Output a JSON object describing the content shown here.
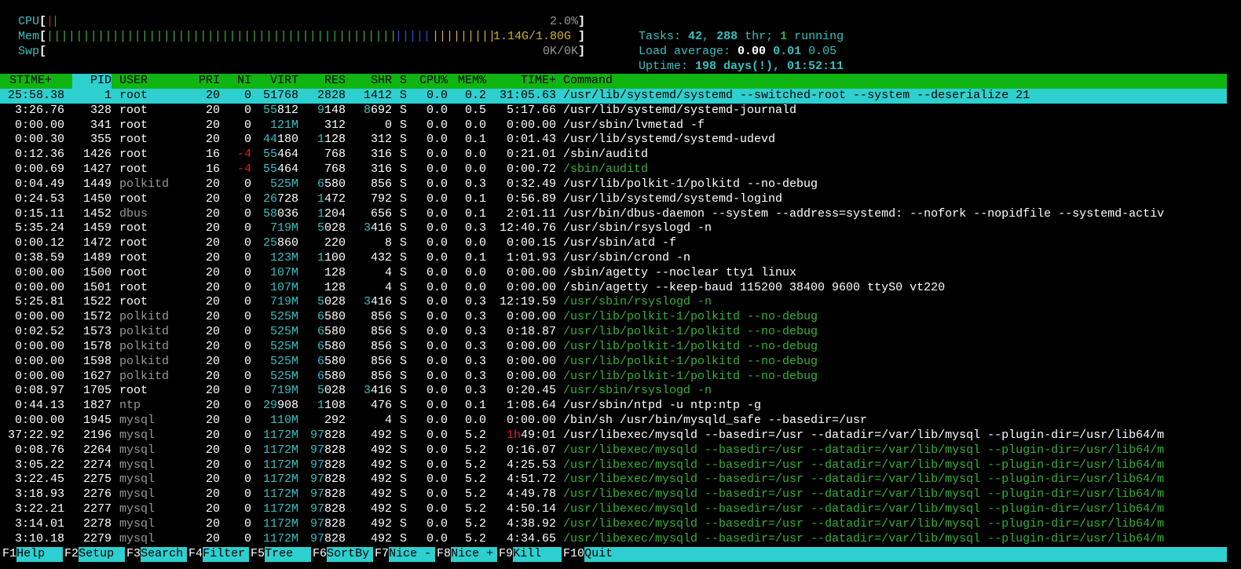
{
  "meters": {
    "cpu": {
      "label": "CPU",
      "value": "2.0%"
    },
    "mem": {
      "label": "Mem",
      "value": "1.14G/1.80G"
    },
    "swp": {
      "label": "Swp",
      "value": "0K/0K"
    }
  },
  "summary": {
    "tasks_label": "Tasks: ",
    "tasks": "42",
    "thr_sep": ", ",
    "thr": "288",
    "thr_label": " thr; ",
    "running": "1",
    "running_label": " running",
    "load_label": "Load average: ",
    "load1": "0.00",
    "load5": "0.01",
    "load15": "0.05",
    "uptime_label": "Uptime: ",
    "uptime": "198 days(!), 01:52:11"
  },
  "columns": [
    "STIME+",
    "PID",
    "USER",
    "PRI",
    "NI",
    "VIRT",
    "RES",
    "SHR",
    "S",
    "CPU%",
    "MEM%",
    "TIME+",
    "Command"
  ],
  "rows": [
    {
      "stime": "25:58.38",
      "pid": "1",
      "user": "root",
      "pri": "20",
      "ni": "0",
      "virt": "51768",
      "res": "2828",
      "shr": "1412",
      "s": "S",
      "cpu": "0.0",
      "mem": "0.2",
      "time": "31:05.63",
      "cmd": "/usr/lib/systemd/systemd --switched-root --system --deserialize 21",
      "selected": true
    },
    {
      "stime": "3:26.76",
      "pid": "328",
      "user": "root",
      "pri": "20",
      "ni": "0",
      "virt": "55812",
      "res": "9148",
      "shr": "8692",
      "s": "S",
      "cpu": "0.0",
      "mem": "0.5",
      "time": "5:17.66",
      "cmd": "/usr/lib/systemd/systemd-journald"
    },
    {
      "stime": "0:00.00",
      "pid": "341",
      "user": "root",
      "pri": "20",
      "ni": "0",
      "virt": "121M",
      "res": "312",
      "shr": "0",
      "s": "S",
      "cpu": "0.0",
      "mem": "0.0",
      "time": "0:00.00",
      "cmd": "/usr/sbin/lvmetad -f"
    },
    {
      "stime": "0:00.30",
      "pid": "355",
      "user": "root",
      "pri": "20",
      "ni": "0",
      "virt": "44180",
      "res": "1128",
      "shr": "312",
      "s": "S",
      "cpu": "0.0",
      "mem": "0.1",
      "time": "0:01.43",
      "cmd": "/usr/lib/systemd/systemd-udevd"
    },
    {
      "stime": "0:12.36",
      "pid": "1426",
      "user": "root",
      "pri": "16",
      "ni": "-4",
      "virt": "55464",
      "res": "768",
      "shr": "316",
      "s": "S",
      "cpu": "0.0",
      "mem": "0.0",
      "time": "0:21.01",
      "cmd": "/sbin/auditd"
    },
    {
      "stime": "0:00.69",
      "pid": "1427",
      "user": "root",
      "pri": "16",
      "ni": "-4",
      "virt": "55464",
      "res": "768",
      "shr": "316",
      "s": "S",
      "cpu": "0.0",
      "mem": "0.0",
      "time": "0:00.72",
      "cmd": "/sbin/auditd",
      "thread": true
    },
    {
      "stime": "0:04.49",
      "pid": "1449",
      "user": "polkitd",
      "pri": "20",
      "ni": "0",
      "virt": "525M",
      "res": "6580",
      "shr": "856",
      "s": "S",
      "cpu": "0.0",
      "mem": "0.3",
      "time": "0:32.49",
      "cmd": "/usr/lib/polkit-1/polkitd --no-debug"
    },
    {
      "stime": "0:24.53",
      "pid": "1450",
      "user": "root",
      "pri": "20",
      "ni": "0",
      "virt": "26728",
      "res": "1472",
      "shr": "792",
      "s": "S",
      "cpu": "0.0",
      "mem": "0.1",
      "time": "0:56.89",
      "cmd": "/usr/lib/systemd/systemd-logind"
    },
    {
      "stime": "0:15.11",
      "pid": "1452",
      "user": "dbus",
      "pri": "20",
      "ni": "0",
      "virt": "58036",
      "res": "1204",
      "shr": "656",
      "s": "S",
      "cpu": "0.0",
      "mem": "0.1",
      "time": "2:01.11",
      "cmd": "/usr/bin/dbus-daemon --system --address=systemd: --nofork --nopidfile --systemd-activ"
    },
    {
      "stime": "5:35.24",
      "pid": "1459",
      "user": "root",
      "pri": "20",
      "ni": "0",
      "virt": "719M",
      "res": "5028",
      "shr": "3416",
      "s": "S",
      "cpu": "0.0",
      "mem": "0.3",
      "time": "12:40.76",
      "cmd": "/usr/sbin/rsyslogd -n"
    },
    {
      "stime": "0:00.12",
      "pid": "1472",
      "user": "root",
      "pri": "20",
      "ni": "0",
      "virt": "25860",
      "res": "220",
      "shr": "8",
      "s": "S",
      "cpu": "0.0",
      "mem": "0.0",
      "time": "0:00.15",
      "cmd": "/usr/sbin/atd -f"
    },
    {
      "stime": "0:38.59",
      "pid": "1489",
      "user": "root",
      "pri": "20",
      "ni": "0",
      "virt": "123M",
      "res": "1100",
      "shr": "432",
      "s": "S",
      "cpu": "0.0",
      "mem": "0.1",
      "time": "1:01.93",
      "cmd": "/usr/sbin/crond -n"
    },
    {
      "stime": "0:00.00",
      "pid": "1500",
      "user": "root",
      "pri": "20",
      "ni": "0",
      "virt": "107M",
      "res": "128",
      "shr": "4",
      "s": "S",
      "cpu": "0.0",
      "mem": "0.0",
      "time": "0:00.00",
      "cmd": "/sbin/agetty --noclear tty1 linux"
    },
    {
      "stime": "0:00.00",
      "pid": "1501",
      "user": "root",
      "pri": "20",
      "ni": "0",
      "virt": "107M",
      "res": "128",
      "shr": "4",
      "s": "S",
      "cpu": "0.0",
      "mem": "0.0",
      "time": "0:00.00",
      "cmd": "/sbin/agetty --keep-baud 115200 38400 9600 ttyS0 vt220"
    },
    {
      "stime": "5:25.81",
      "pid": "1522",
      "user": "root",
      "pri": "20",
      "ni": "0",
      "virt": "719M",
      "res": "5028",
      "shr": "3416",
      "s": "S",
      "cpu": "0.0",
      "mem": "0.3",
      "time": "12:19.59",
      "cmd": "/usr/sbin/rsyslogd -n",
      "thread": true
    },
    {
      "stime": "0:00.00",
      "pid": "1572",
      "user": "polkitd",
      "pri": "20",
      "ni": "0",
      "virt": "525M",
      "res": "6580",
      "shr": "856",
      "s": "S",
      "cpu": "0.0",
      "mem": "0.3",
      "time": "0:00.00",
      "cmd": "/usr/lib/polkit-1/polkitd --no-debug",
      "thread": true
    },
    {
      "stime": "0:02.52",
      "pid": "1573",
      "user": "polkitd",
      "pri": "20",
      "ni": "0",
      "virt": "525M",
      "res": "6580",
      "shr": "856",
      "s": "S",
      "cpu": "0.0",
      "mem": "0.3",
      "time": "0:18.87",
      "cmd": "/usr/lib/polkit-1/polkitd --no-debug",
      "thread": true
    },
    {
      "stime": "0:00.00",
      "pid": "1578",
      "user": "polkitd",
      "pri": "20",
      "ni": "0",
      "virt": "525M",
      "res": "6580",
      "shr": "856",
      "s": "S",
      "cpu": "0.0",
      "mem": "0.3",
      "time": "0:00.00",
      "cmd": "/usr/lib/polkit-1/polkitd --no-debug",
      "thread": true
    },
    {
      "stime": "0:00.00",
      "pid": "1598",
      "user": "polkitd",
      "pri": "20",
      "ni": "0",
      "virt": "525M",
      "res": "6580",
      "shr": "856",
      "s": "S",
      "cpu": "0.0",
      "mem": "0.3",
      "time": "0:00.00",
      "cmd": "/usr/lib/polkit-1/polkitd --no-debug",
      "thread": true
    },
    {
      "stime": "0:00.00",
      "pid": "1627",
      "user": "polkitd",
      "pri": "20",
      "ni": "0",
      "virt": "525M",
      "res": "6580",
      "shr": "856",
      "s": "S",
      "cpu": "0.0",
      "mem": "0.3",
      "time": "0:00.00",
      "cmd": "/usr/lib/polkit-1/polkitd --no-debug",
      "thread": true
    },
    {
      "stime": "0:08.97",
      "pid": "1705",
      "user": "root",
      "pri": "20",
      "ni": "0",
      "virt": "719M",
      "res": "5028",
      "shr": "3416",
      "s": "S",
      "cpu": "0.0",
      "mem": "0.3",
      "time": "0:20.45",
      "cmd": "/usr/sbin/rsyslogd -n",
      "thread": true
    },
    {
      "stime": "0:44.13",
      "pid": "1827",
      "user": "ntp",
      "pri": "20",
      "ni": "0",
      "virt": "29908",
      "res": "1108",
      "shr": "476",
      "s": "S",
      "cpu": "0.0",
      "mem": "0.1",
      "time": "1:08.64",
      "cmd": "/usr/sbin/ntpd -u ntp:ntp -g"
    },
    {
      "stime": "0:00.00",
      "pid": "1945",
      "user": "mysql",
      "pri": "20",
      "ni": "0",
      "virt": "110M",
      "res": "292",
      "shr": "4",
      "s": "S",
      "cpu": "0.0",
      "mem": "0.0",
      "time": "0:00.00",
      "cmd": "/bin/sh /usr/bin/mysqld_safe --basedir=/usr"
    },
    {
      "stime": "37:22.92",
      "pid": "2196",
      "user": "mysql",
      "pri": "20",
      "ni": "0",
      "virt": "1172M",
      "res": "97828",
      "shr": "492",
      "s": "S",
      "cpu": "0.0",
      "mem": "5.2",
      "time": "1h49:01",
      "cmd": "/usr/libexec/mysqld --basedir=/usr --datadir=/var/lib/mysql --plugin-dir=/usr/lib64/m"
    },
    {
      "stime": "0:08.76",
      "pid": "2264",
      "user": "mysql",
      "pri": "20",
      "ni": "0",
      "virt": "1172M",
      "res": "97828",
      "shr": "492",
      "s": "S",
      "cpu": "0.0",
      "mem": "5.2",
      "time": "0:16.07",
      "cmd": "/usr/libexec/mysqld --basedir=/usr --datadir=/var/lib/mysql --plugin-dir=/usr/lib64/m",
      "thread": true
    },
    {
      "stime": "3:05.22",
      "pid": "2274",
      "user": "mysql",
      "pri": "20",
      "ni": "0",
      "virt": "1172M",
      "res": "97828",
      "shr": "492",
      "s": "S",
      "cpu": "0.0",
      "mem": "5.2",
      "time": "4:25.53",
      "cmd": "/usr/libexec/mysqld --basedir=/usr --datadir=/var/lib/mysql --plugin-dir=/usr/lib64/m",
      "thread": true
    },
    {
      "stime": "3:22.45",
      "pid": "2275",
      "user": "mysql",
      "pri": "20",
      "ni": "0",
      "virt": "1172M",
      "res": "97828",
      "shr": "492",
      "s": "S",
      "cpu": "0.0",
      "mem": "5.2",
      "time": "4:51.72",
      "cmd": "/usr/libexec/mysqld --basedir=/usr --datadir=/var/lib/mysql --plugin-dir=/usr/lib64/m",
      "thread": true
    },
    {
      "stime": "3:18.93",
      "pid": "2276",
      "user": "mysql",
      "pri": "20",
      "ni": "0",
      "virt": "1172M",
      "res": "97828",
      "shr": "492",
      "s": "S",
      "cpu": "0.0",
      "mem": "5.2",
      "time": "4:49.78",
      "cmd": "/usr/libexec/mysqld --basedir=/usr --datadir=/var/lib/mysql --plugin-dir=/usr/lib64/m",
      "thread": true
    },
    {
      "stime": "3:22.21",
      "pid": "2277",
      "user": "mysql",
      "pri": "20",
      "ni": "0",
      "virt": "1172M",
      "res": "97828",
      "shr": "492",
      "s": "S",
      "cpu": "0.0",
      "mem": "5.2",
      "time": "4:50.14",
      "cmd": "/usr/libexec/mysqld --basedir=/usr --datadir=/var/lib/mysql --plugin-dir=/usr/lib64/m",
      "thread": true
    },
    {
      "stime": "3:14.01",
      "pid": "2278",
      "user": "mysql",
      "pri": "20",
      "ni": "0",
      "virt": "1172M",
      "res": "97828",
      "shr": "492",
      "s": "S",
      "cpu": "0.0",
      "mem": "5.2",
      "time": "4:38.92",
      "cmd": "/usr/libexec/mysqld --basedir=/usr --datadir=/var/lib/mysql --plugin-dir=/usr/lib64/m",
      "thread": true
    },
    {
      "stime": "3:10.18",
      "pid": "2279",
      "user": "mysql",
      "pri": "20",
      "ni": "0",
      "virt": "1172M",
      "res": "97828",
      "shr": "492",
      "s": "S",
      "cpu": "0.0",
      "mem": "5.2",
      "time": "4:34.65",
      "cmd": "/usr/libexec/mysqld --basedir=/usr --datadir=/var/lib/mysql --plugin-dir=/usr/lib64/m",
      "thread": true
    }
  ],
  "function_keys": [
    {
      "key": "F1",
      "label": "Help"
    },
    {
      "key": "F2",
      "label": "Setup"
    },
    {
      "key": "F3",
      "label": "Search"
    },
    {
      "key": "F4",
      "label": "Filter"
    },
    {
      "key": "F5",
      "label": "Tree"
    },
    {
      "key": "F6",
      "label": "SortBy"
    },
    {
      "key": "F7",
      "label": "Nice -"
    },
    {
      "key": "F8",
      "label": "Nice +"
    },
    {
      "key": "F9",
      "label": "Kill"
    },
    {
      "key": "F10",
      "label": "Quit"
    }
  ],
  "colors": {
    "header_bg": "#11b511",
    "selected_bg": "#2ecfcf",
    "accent": "#36c0c0",
    "thread": "#37b137"
  }
}
